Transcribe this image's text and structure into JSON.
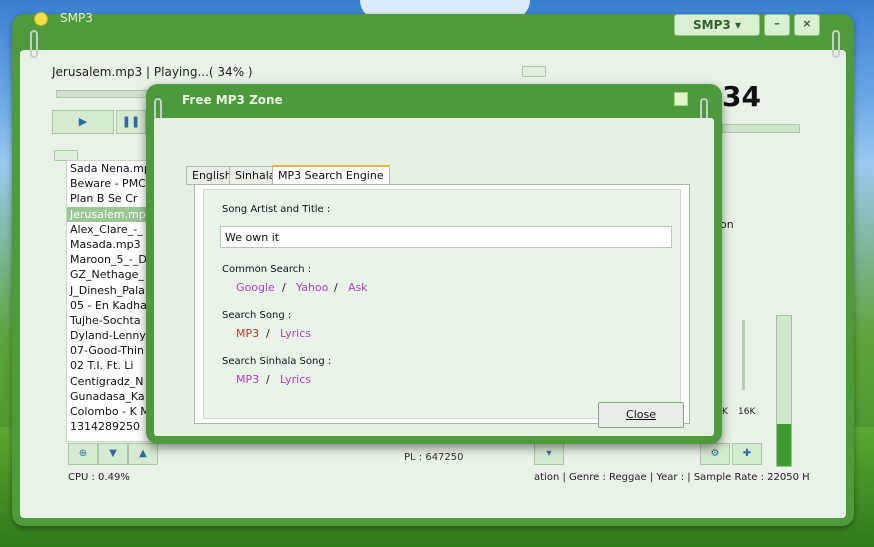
{
  "app": {
    "title": "SMP3",
    "skin_button": "SMP3 ▾",
    "minimize": "–",
    "close": "×"
  },
  "player": {
    "now_playing": "Jerusalem.mp3 | Playing...( 34% )",
    "progress_percent": 34,
    "time_display": "34",
    "play_icon": "play-icon",
    "pause_icon": "pause-icon"
  },
  "playlist": {
    "items": [
      "Sada Nena.mp",
      "Beware - PMC",
      "Plan B   Se Cr",
      "Jerusalem.mp",
      "Alex_Clare_-_",
      "Masada.mp3",
      "Maroon_5_-_D",
      "GZ_Nethage_",
      "J_Dinesh_Pala",
      "05 - En Kadha",
      "Tujhe-Sochta",
      "Dyland-Lenny-",
      "07-Good-Thin",
      "02 T.I.  Ft. Li",
      "Centigradz_N",
      "Gunadasa_Ka",
      "Colombo - K M",
      "1314289250"
    ],
    "selected_index": 3,
    "count_label": "PL : 647250"
  },
  "side": {
    "partial_text": "on",
    "eq_labels": [
      "K",
      "16K"
    ],
    "volume_level": 0.28
  },
  "status": {
    "cpu": "CPU : 0.49%",
    "info": "ation | Genre : Reggae | Year :  | Sample Rate : 22050 H"
  },
  "dialog": {
    "title": "Free MP3 Zone",
    "tabs": [
      "English",
      "Sinhala",
      "MP3 Search Engine"
    ],
    "active_tab": 2,
    "song_label": "Song Artist and Title :",
    "song_value": "We own it",
    "common_label": "Common Search :",
    "common_links": [
      "Google",
      "Yahoo",
      "Ask"
    ],
    "search_song_label": "Search Song :",
    "search_song_links": [
      "MP3",
      "Lyrics"
    ],
    "sinhala_label": "Search Sinhala Song :",
    "sinhala_links": [
      "MP3",
      "Lyrics"
    ],
    "separator": "/",
    "close_label": "Close"
  }
}
